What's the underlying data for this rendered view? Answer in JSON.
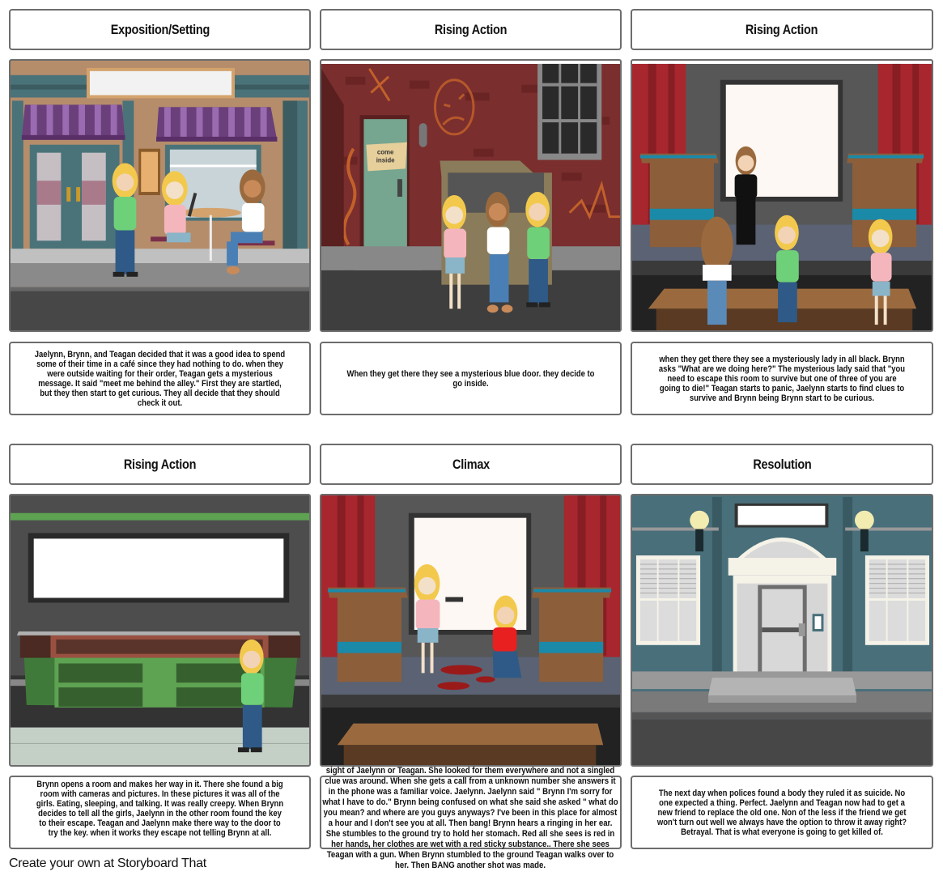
{
  "storyboard": {
    "footer": "Create your own at Storyboard That",
    "panels": [
      {
        "title": "Exposition/Setting",
        "scene": "cafe-storefront",
        "text": "Jaelynn, Brynn, and Teagan decided that it was a good idea to spend some of their time in a café since they had nothing to do. when they were outside waiting for their order, Teagan gets a mysterious message. It said \"meet me behind the alley.\" First they are startled, but they then start to get curious. They all decide that they should check it out."
      },
      {
        "title": "Rising Action",
        "scene": "alley-door",
        "sign_text": "come inside",
        "text": "When they get there they see a mysterious blue door. they decide to go inside."
      },
      {
        "title": "Rising Action",
        "scene": "stage-mysterious-lady",
        "text": "when they get there they see a mysteriously lady in all black. Brynn asks \"What are we doing here?\" The mysterious lady said that \"you need to escape this room to survive but one of three of you are going to die!\" Teagan starts to panic, Jaelynn starts to find clues to survive and Brynn being Brynn start to be curious."
      },
      {
        "title": "Rising Action",
        "scene": "surveillance-room",
        "text": "Brynn opens a room and makes her way in it. There she found a big room with cameras and pictures. In these pictures it was all of the girls. Eating, sleeping, and talking. It was really creepy. When Brynn decides to tell all the girls, Jaelynn in the other room found the key to their escape. Teagan and Jaelynn make there way to the door to try the key. when it works they escape not telling Brynn at all."
      },
      {
        "title": "Climax",
        "scene": "stage-shooting",
        "text": "sight of Jaelynn or Teagan. She looked for them everywhere and not a singled clue was around.  When she gets a call from a unknown number she answers it in the phone was a familiar voice. Jaelynn. Jaelynn said \" Brynn I'm sorry for what I have to do.\" Brynn being confused on what she said she asked \" what do you mean? and where are you guys anyways? I've been in this place for almost a hour and I don't see you at all. Then bang! Brynn hears a ringing in her ear. She stumbles to the ground try to hold her stomach. Red all she sees is red in her hands, her clothes are wet with a red sticky substance.. There she sees Teagan with a gun. When Brynn stumbled to the ground Teagan walks over to her. Then BANG another shot was made."
      },
      {
        "title": "Resolution",
        "scene": "building-entrance",
        "text": "The next day when polices found a body they ruled it as suicide. No one expected a thing. Perfect. Jaelynn and Teagan now had to get a new friend to replace the old one. Non of the less if the friend we get won't turn out well we always have the option to throw it away right? Betrayal. That is what everyone is going to get killed of."
      }
    ]
  }
}
